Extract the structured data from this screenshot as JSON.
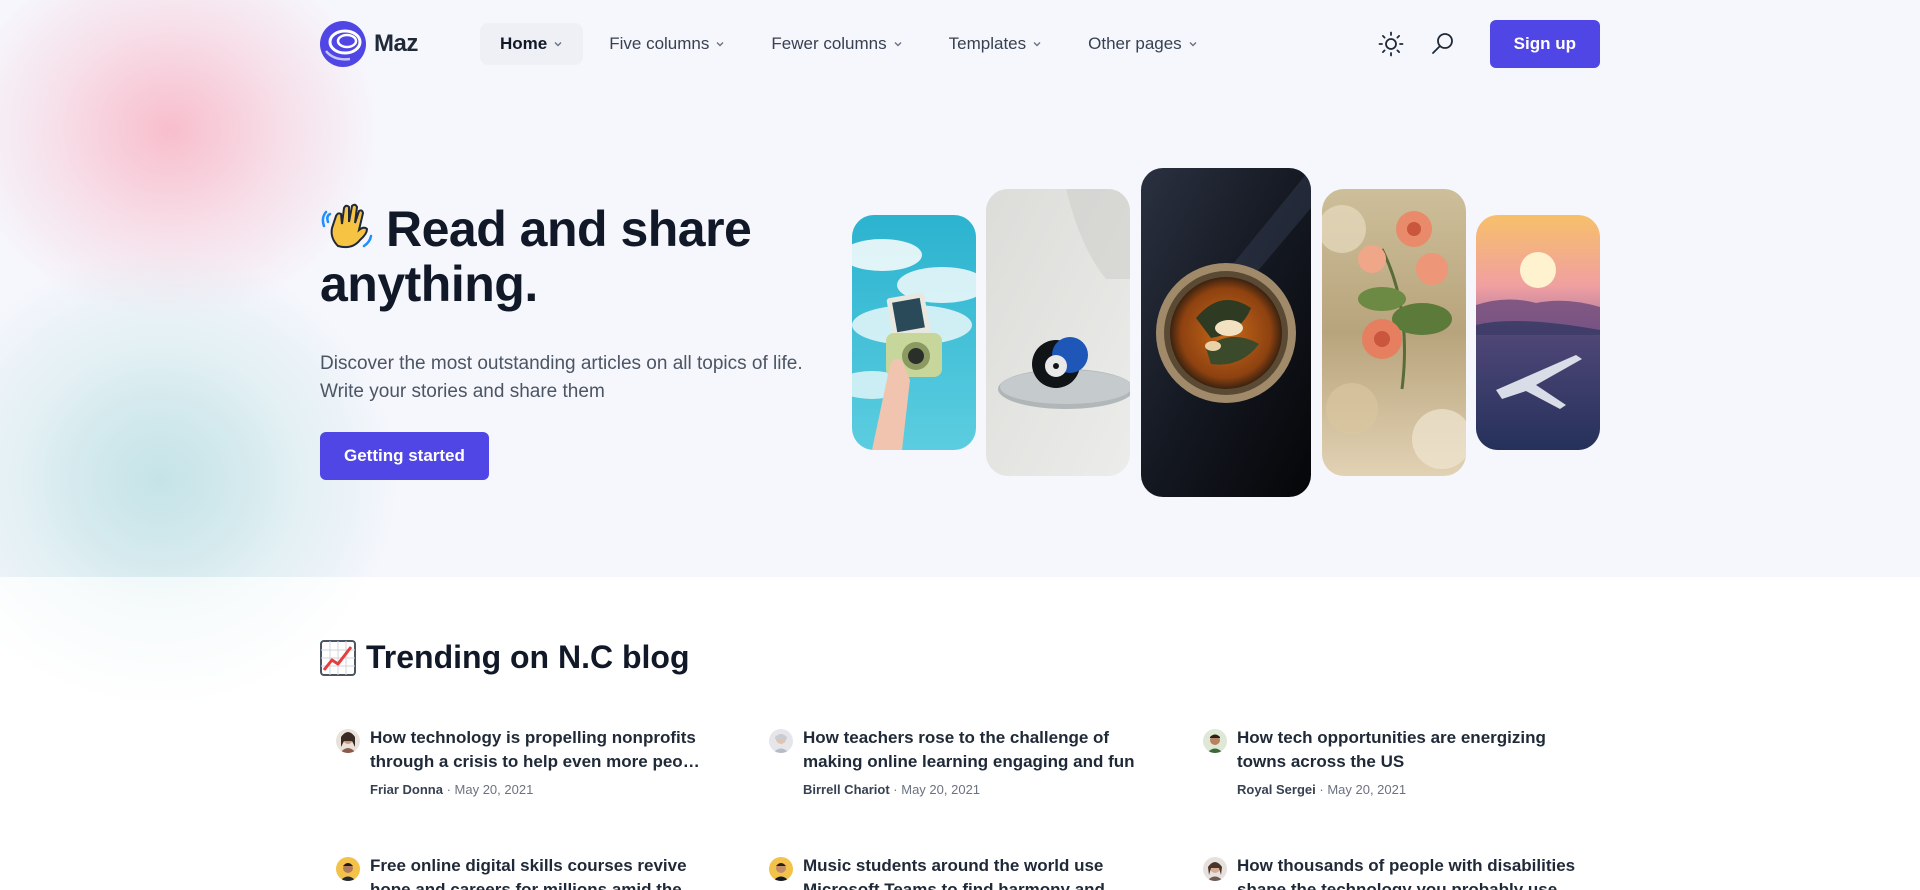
{
  "brand": {
    "name": "Maz"
  },
  "nav": {
    "items": [
      {
        "label": "Home"
      },
      {
        "label": "Five columns"
      },
      {
        "label": "Fewer columns"
      },
      {
        "label": "Templates"
      },
      {
        "label": "Other pages"
      }
    ]
  },
  "header": {
    "signup_label": "Sign up"
  },
  "hero": {
    "title_line1": "Read and share",
    "title_line2": "anything.",
    "description": "Discover the most outstanding articles on all topics of life. Write your stories and share them",
    "cta_label": "Getting started"
  },
  "trending": {
    "title": "Trending on N.C blog",
    "posts": [
      {
        "title": "How technology is propelling nonprofits through a crisis to help even more people in need",
        "author": "Friar Donna",
        "date": "May 20, 2021"
      },
      {
        "title": "How teachers rose to the challenge of making online learning engaging and fun",
        "author": "Birrell Chariot",
        "date": "May 20, 2021"
      },
      {
        "title": "How tech opportunities are energizing towns across the US",
        "author": "Royal Sergei",
        "date": "May 20, 2021"
      },
      {
        "title": "Free online digital skills courses revive hope and careers for millions amid the pandemic",
        "author": "",
        "date": ""
      },
      {
        "title": "Music students around the world use Microsoft Teams to find harmony and well-being",
        "author": "",
        "date": ""
      },
      {
        "title": "How thousands of people with disabilities shape the technology you probably use",
        "author": "",
        "date": ""
      }
    ]
  },
  "colors": {
    "accent": "#4f46e5",
    "hero_bg": "#f6f7fd"
  },
  "icons": [
    "logo-icon",
    "chevron-down-icon",
    "sun-icon",
    "search-icon",
    "waving-hand-icon",
    "chart-increasing-icon"
  ]
}
